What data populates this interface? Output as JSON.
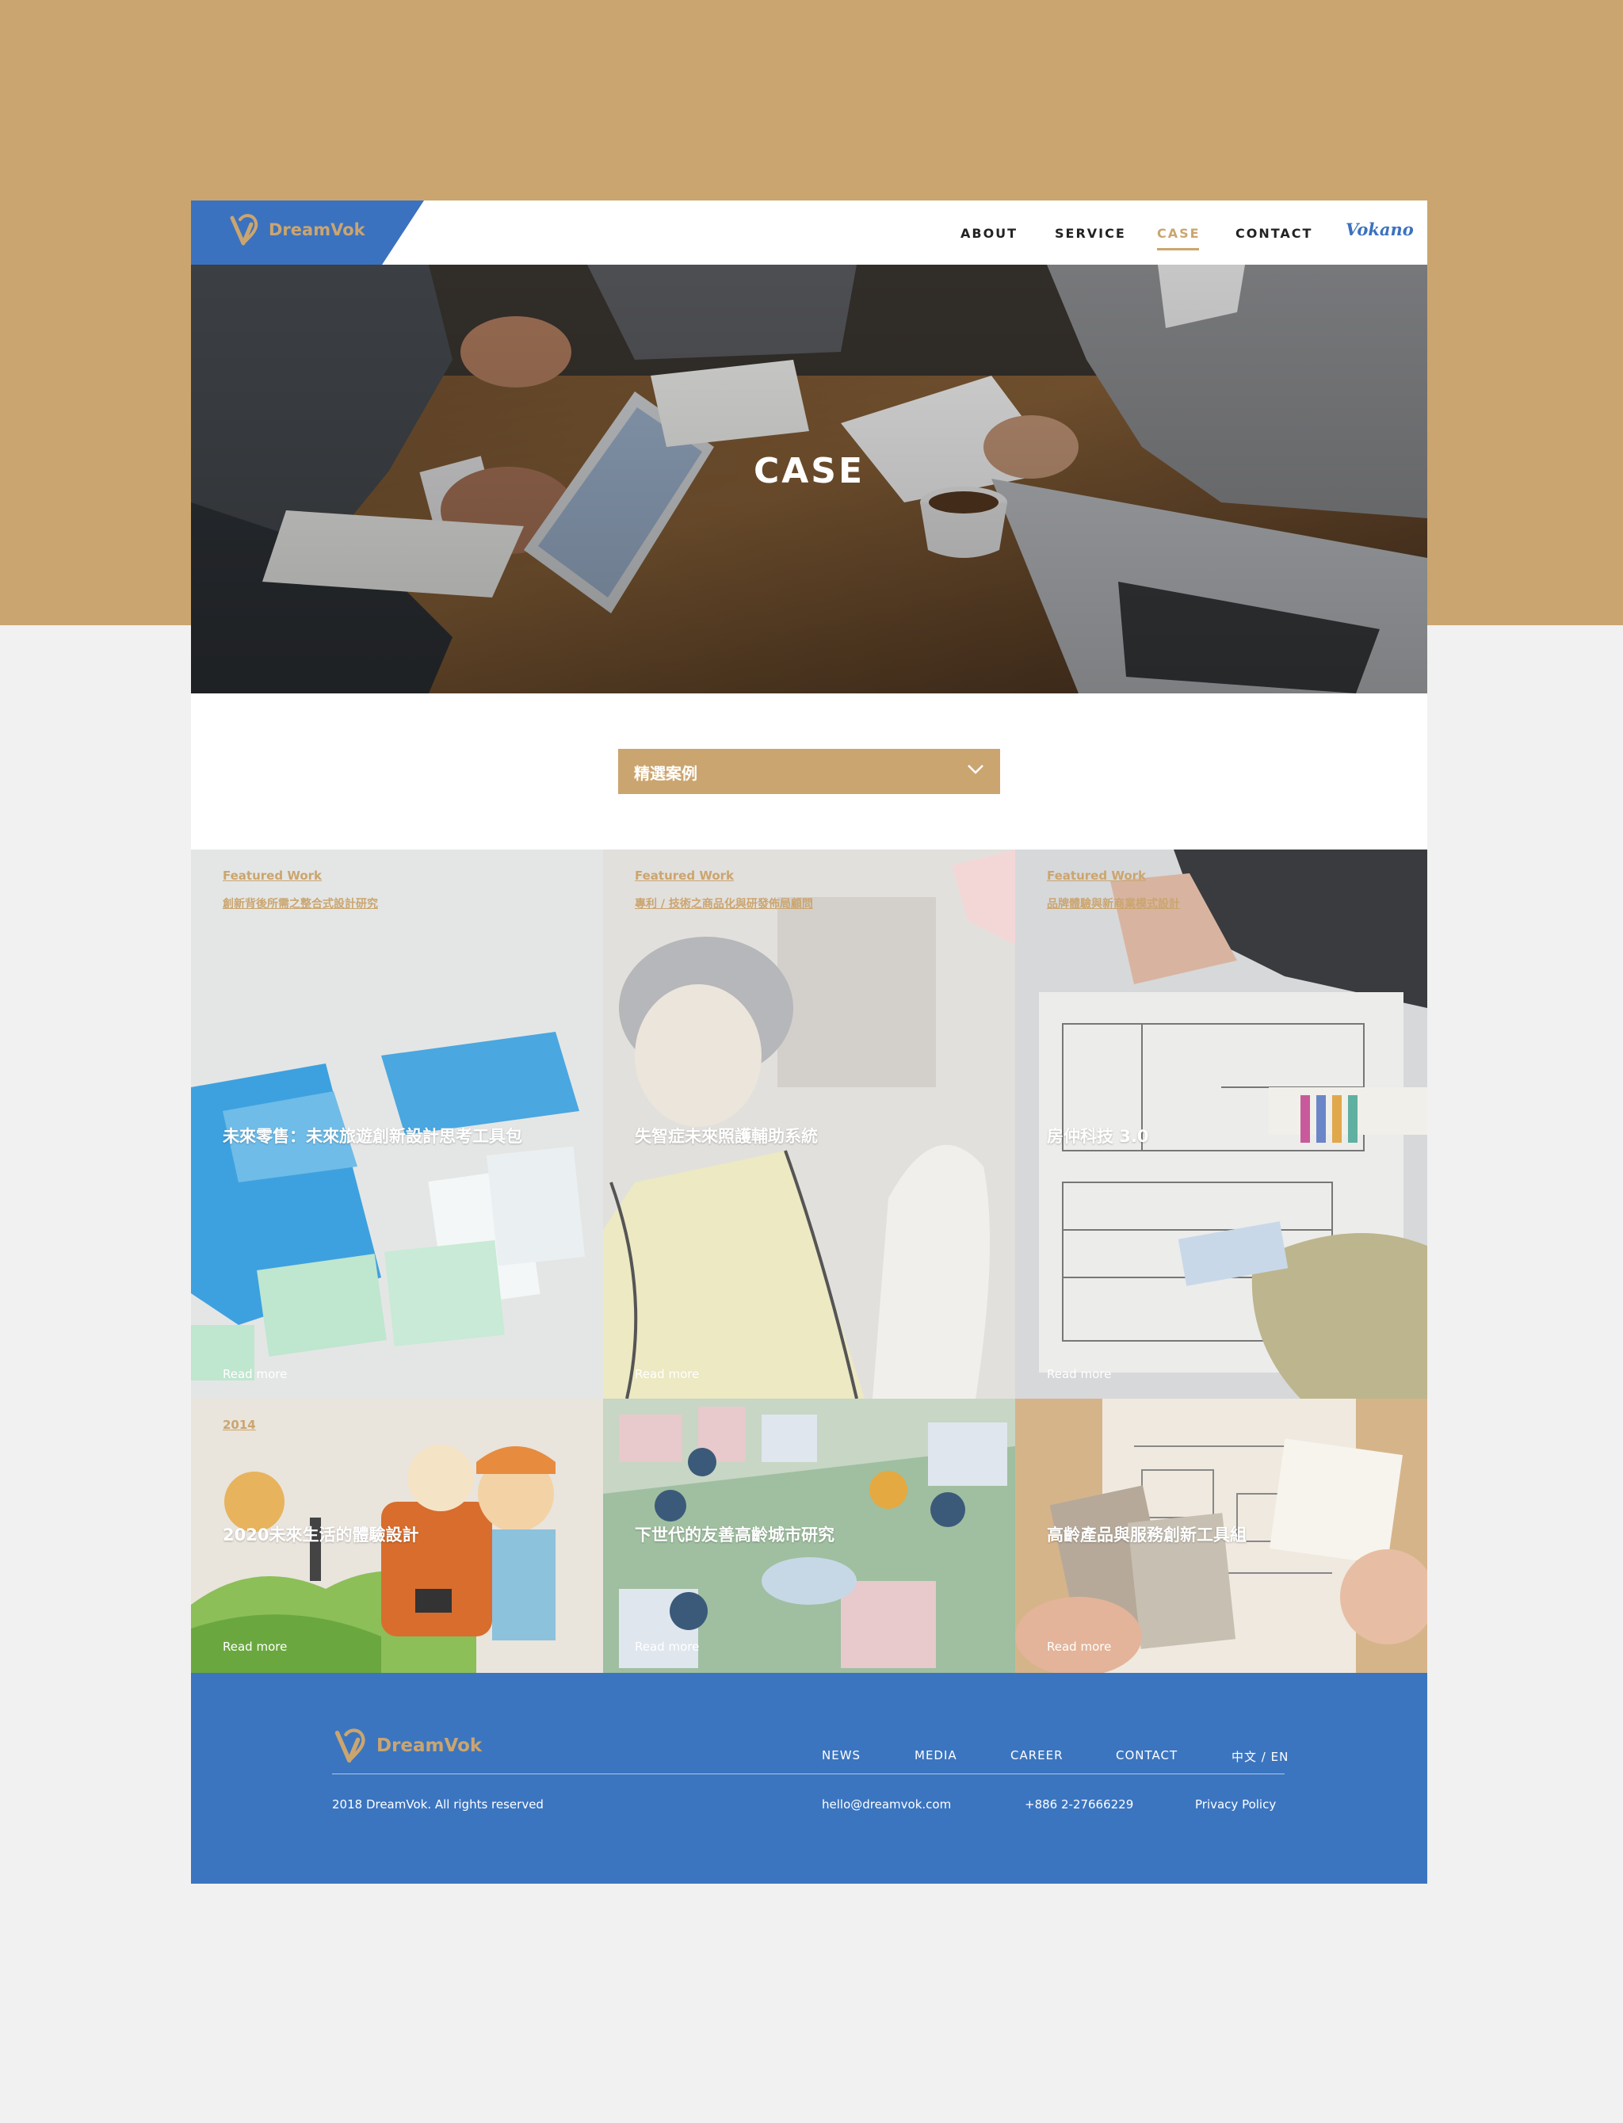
{
  "header": {
    "logo_text": "DreamVok",
    "nav": [
      {
        "label": "ABOUT"
      },
      {
        "label": "SERVICE"
      },
      {
        "label": "CASE"
      },
      {
        "label": "CONTACT"
      }
    ],
    "brand_link": "Vokano"
  },
  "hero": {
    "title": "CASE"
  },
  "filter": {
    "selected": "精選案例"
  },
  "cases": [
    {
      "tag": "Featured Work",
      "subtitle": "創新背後所需之整合式設計研究",
      "title": "未來零售：未來旅遊創新設計思考工具包",
      "more": "Read more"
    },
    {
      "tag": "Featured Work",
      "subtitle": "專利 / 技術之商品化與研發佈局顧問",
      "title": "失智症未來照護輔助系統",
      "more": "Read more"
    },
    {
      "tag": "Featured Work",
      "subtitle": "品牌體驗與新商業模式設計",
      "title": "房仲科技 3.0",
      "more": "Read more"
    },
    {
      "tag": "2014",
      "title": "2020未來生活的體驗設計",
      "more": "Read more"
    },
    {
      "tag": "",
      "title": "下世代的友善高齡城市研究",
      "more": "Read more"
    },
    {
      "tag": "",
      "title": "高齡產品與服務創新工具組",
      "more": "Read more"
    }
  ],
  "footer": {
    "logo_text": "DreamVok",
    "nav": [
      {
        "label": "NEWS"
      },
      {
        "label": "MEDIA"
      },
      {
        "label": "CAREER"
      },
      {
        "label": "CONTACT"
      },
      {
        "label": "中文 / EN"
      }
    ],
    "copyright": "2018 DreamVok. All rights reserved",
    "email": "hello@dreamvok.com",
    "phone": "+886 2-27666229",
    "privacy": "Privacy Policy"
  },
  "colors": {
    "gold": "#cba56f",
    "blue": "#3b72bf",
    "page_bg": "#f1f1f1"
  }
}
